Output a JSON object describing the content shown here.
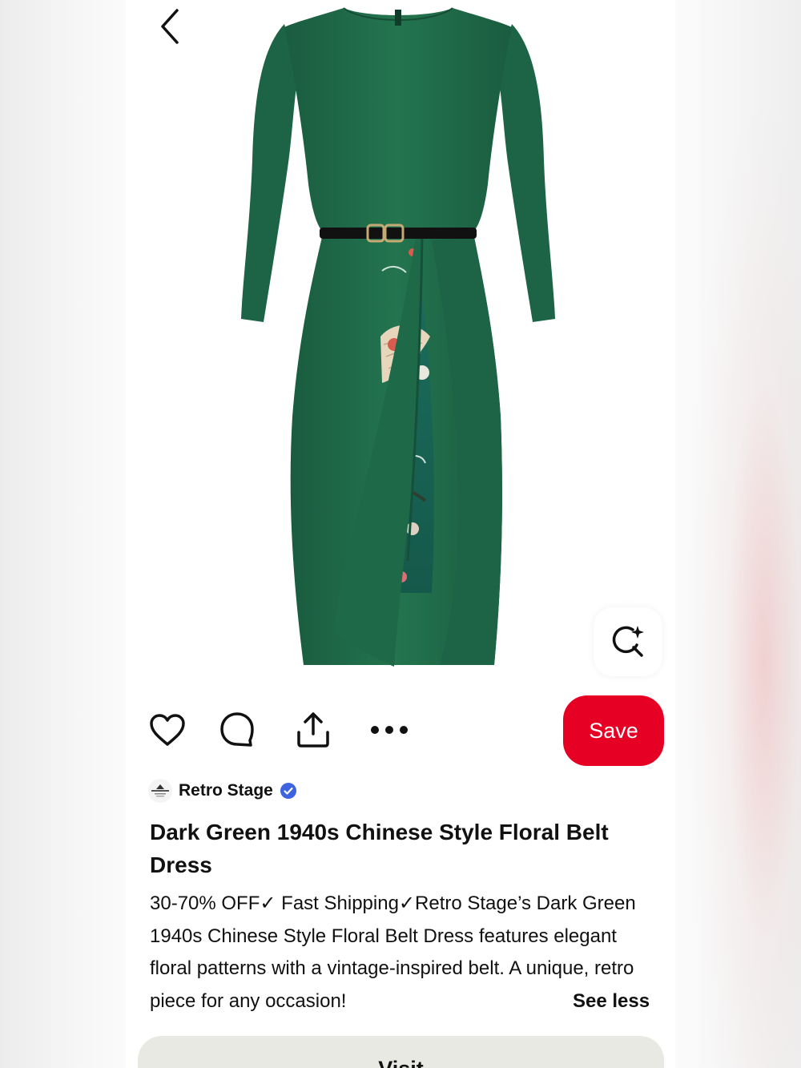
{
  "actions": {
    "save_label": "Save",
    "visit_label": "Visit"
  },
  "creator": {
    "name": "Retro Stage",
    "verified": true
  },
  "pin": {
    "title": "Dark Green 1940s Chinese Style Floral Belt Dress",
    "description": "30-70% OFF✓ Fast Shipping✓Retro Stage’s Dark Green 1940s Chinese Style Floral Belt Dress features elegant floral patterns with a vintage-inspired belt. A unique, retro piece for any occasion!",
    "see_less_label": "See less"
  },
  "icons": [
    "back-arrow-icon",
    "visual-search-icon",
    "heart-icon",
    "comment-icon",
    "share-icon",
    "more-icon",
    "verified-badge-icon"
  ],
  "colors": {
    "save_button": "#e60023",
    "visit_button": "#e9e9e4",
    "dress_green": "#1f6b4a",
    "verified_blue": "#3d63e0"
  }
}
